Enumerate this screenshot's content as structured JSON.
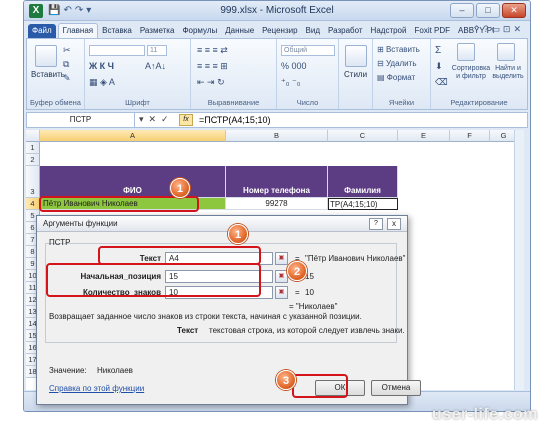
{
  "window": {
    "title": "999.xlsx - Microsoft Excel",
    "app_icon": "X"
  },
  "ribbon": {
    "tabs": [
      "Файл",
      "Главная",
      "Вставка",
      "Разметка",
      "Формулы",
      "Данные",
      "Рецензир",
      "Вид",
      "Разработ",
      "Надстрой",
      "Foxit PDF",
      "ABBYY PI"
    ],
    "active_tab": "Главная",
    "groups": {
      "clipboard": "Буфер обмена",
      "font": "Шрифт",
      "alignment": "Выравнивание",
      "number": "Число",
      "cells": "Ячейки",
      "editing": "Редактирование"
    },
    "paste_label": "Вставить",
    "font_size": "11",
    "number_format": "Общий",
    "styles_label": "Стили",
    "insert_label": "Вставить",
    "delete_label": "Удалить",
    "format_label": "Формат",
    "sort_label": "Сортировка и фильтр",
    "find_label": "Найти и выделить",
    "font_buttons": "Ж  К  Ч",
    "number_buttons": "% 000"
  },
  "formula_bar": {
    "name_box": "ПСТР",
    "formula": "=ПСТР(A4;15;10)"
  },
  "grid": {
    "columns": [
      "A",
      "B",
      "C",
      "E",
      "F",
      "G"
    ],
    "rows": [
      "1",
      "2",
      "3",
      "4",
      "5",
      "6",
      "7",
      "8",
      "9",
      "10",
      "11",
      "12",
      "13",
      "14",
      "15",
      "16",
      "17",
      "18"
    ],
    "header_row": {
      "fio": "ФИО",
      "phone": "Номер телефона",
      "surname": "Фамилия"
    },
    "data_row": {
      "a4": "Пётр Иванович Николаев",
      "b4": "99278",
      "c4": "ТР(A4;15;10)"
    }
  },
  "dialog": {
    "title": "Аргументы функции",
    "help": "?",
    "close": "x",
    "function_name": "ПСТР",
    "args": [
      {
        "label": "Текст",
        "value": "A4",
        "result": "\"Пётр Иванович Николаев\""
      },
      {
        "label": "Начальная_позиция",
        "value": "15",
        "result": "15"
      },
      {
        "label": "Количество_знаков",
        "value": "10",
        "result": "10"
      }
    ],
    "func_result": "= \"Николаев\"",
    "description": "Возвращает заданное число знаков из строки текста, начиная с указанной позиции.",
    "arg_help_name": "Текст",
    "arg_help_text": "текстовая строка, из которой следует извлечь знаки.",
    "value_label": "Значение:",
    "value": "Николаев",
    "help_link": "Справка по этой функции",
    "ok": "ОК",
    "cancel": "Отмена"
  },
  "annotations": {
    "markers": [
      "1",
      "1",
      "2",
      "3"
    ],
    "color": "#d4141b"
  },
  "watermark": "user-life.com",
  "colors": {
    "header_fill": "#5c3c82",
    "selected_cell_fill": "#8dc63f",
    "accent_red": "#d4141b"
  }
}
